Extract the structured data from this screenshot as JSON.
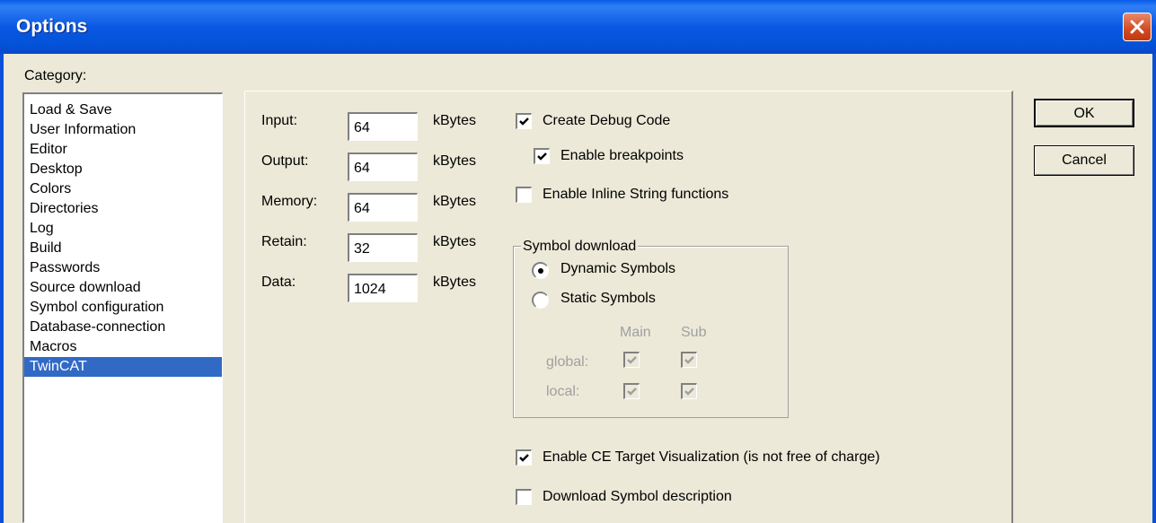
{
  "window": {
    "title": "Options"
  },
  "category": {
    "label": "Category:",
    "items": [
      "Load & Save",
      "User Information",
      "Editor",
      "Desktop",
      "Colors",
      "Directories",
      "Log",
      "Build",
      "Passwords",
      "Source download",
      "Symbol configuration",
      "Database-connection",
      "Macros",
      "TwinCAT"
    ],
    "selected": "TwinCAT"
  },
  "memory": {
    "input": {
      "label": "Input:",
      "value": "64",
      "unit": "kBytes"
    },
    "output": {
      "label": "Output:",
      "value": "64",
      "unit": "kBytes"
    },
    "memory": {
      "label": "Memory:",
      "value": "64",
      "unit": "kBytes"
    },
    "retain": {
      "label": "Retain:",
      "value": "32",
      "unit": "kBytes"
    },
    "data": {
      "label": "Data:",
      "value": "1024",
      "unit": "kBytes"
    }
  },
  "options": {
    "create_debug_code": {
      "label": "Create Debug Code",
      "checked": true
    },
    "enable_breakpoints": {
      "label": "Enable breakpoints",
      "checked": true
    },
    "enable_inline_string": {
      "label": "Enable Inline String functions",
      "checked": false
    },
    "enable_ce_target": {
      "label": "Enable CE Target Visualization (is not free of charge)",
      "checked": true
    },
    "download_symbol_desc": {
      "label": "Download Symbol description",
      "checked": false
    }
  },
  "symbol_download": {
    "label": "Symbol download",
    "dynamic": {
      "label": "Dynamic Symbols",
      "selected": true
    },
    "static": {
      "label": "Static Symbols",
      "selected": false
    },
    "col_main": "Main",
    "col_sub": "Sub",
    "row_global": "global:",
    "row_local": "local:"
  },
  "buttons": {
    "ok": "OK",
    "cancel": "Cancel"
  }
}
